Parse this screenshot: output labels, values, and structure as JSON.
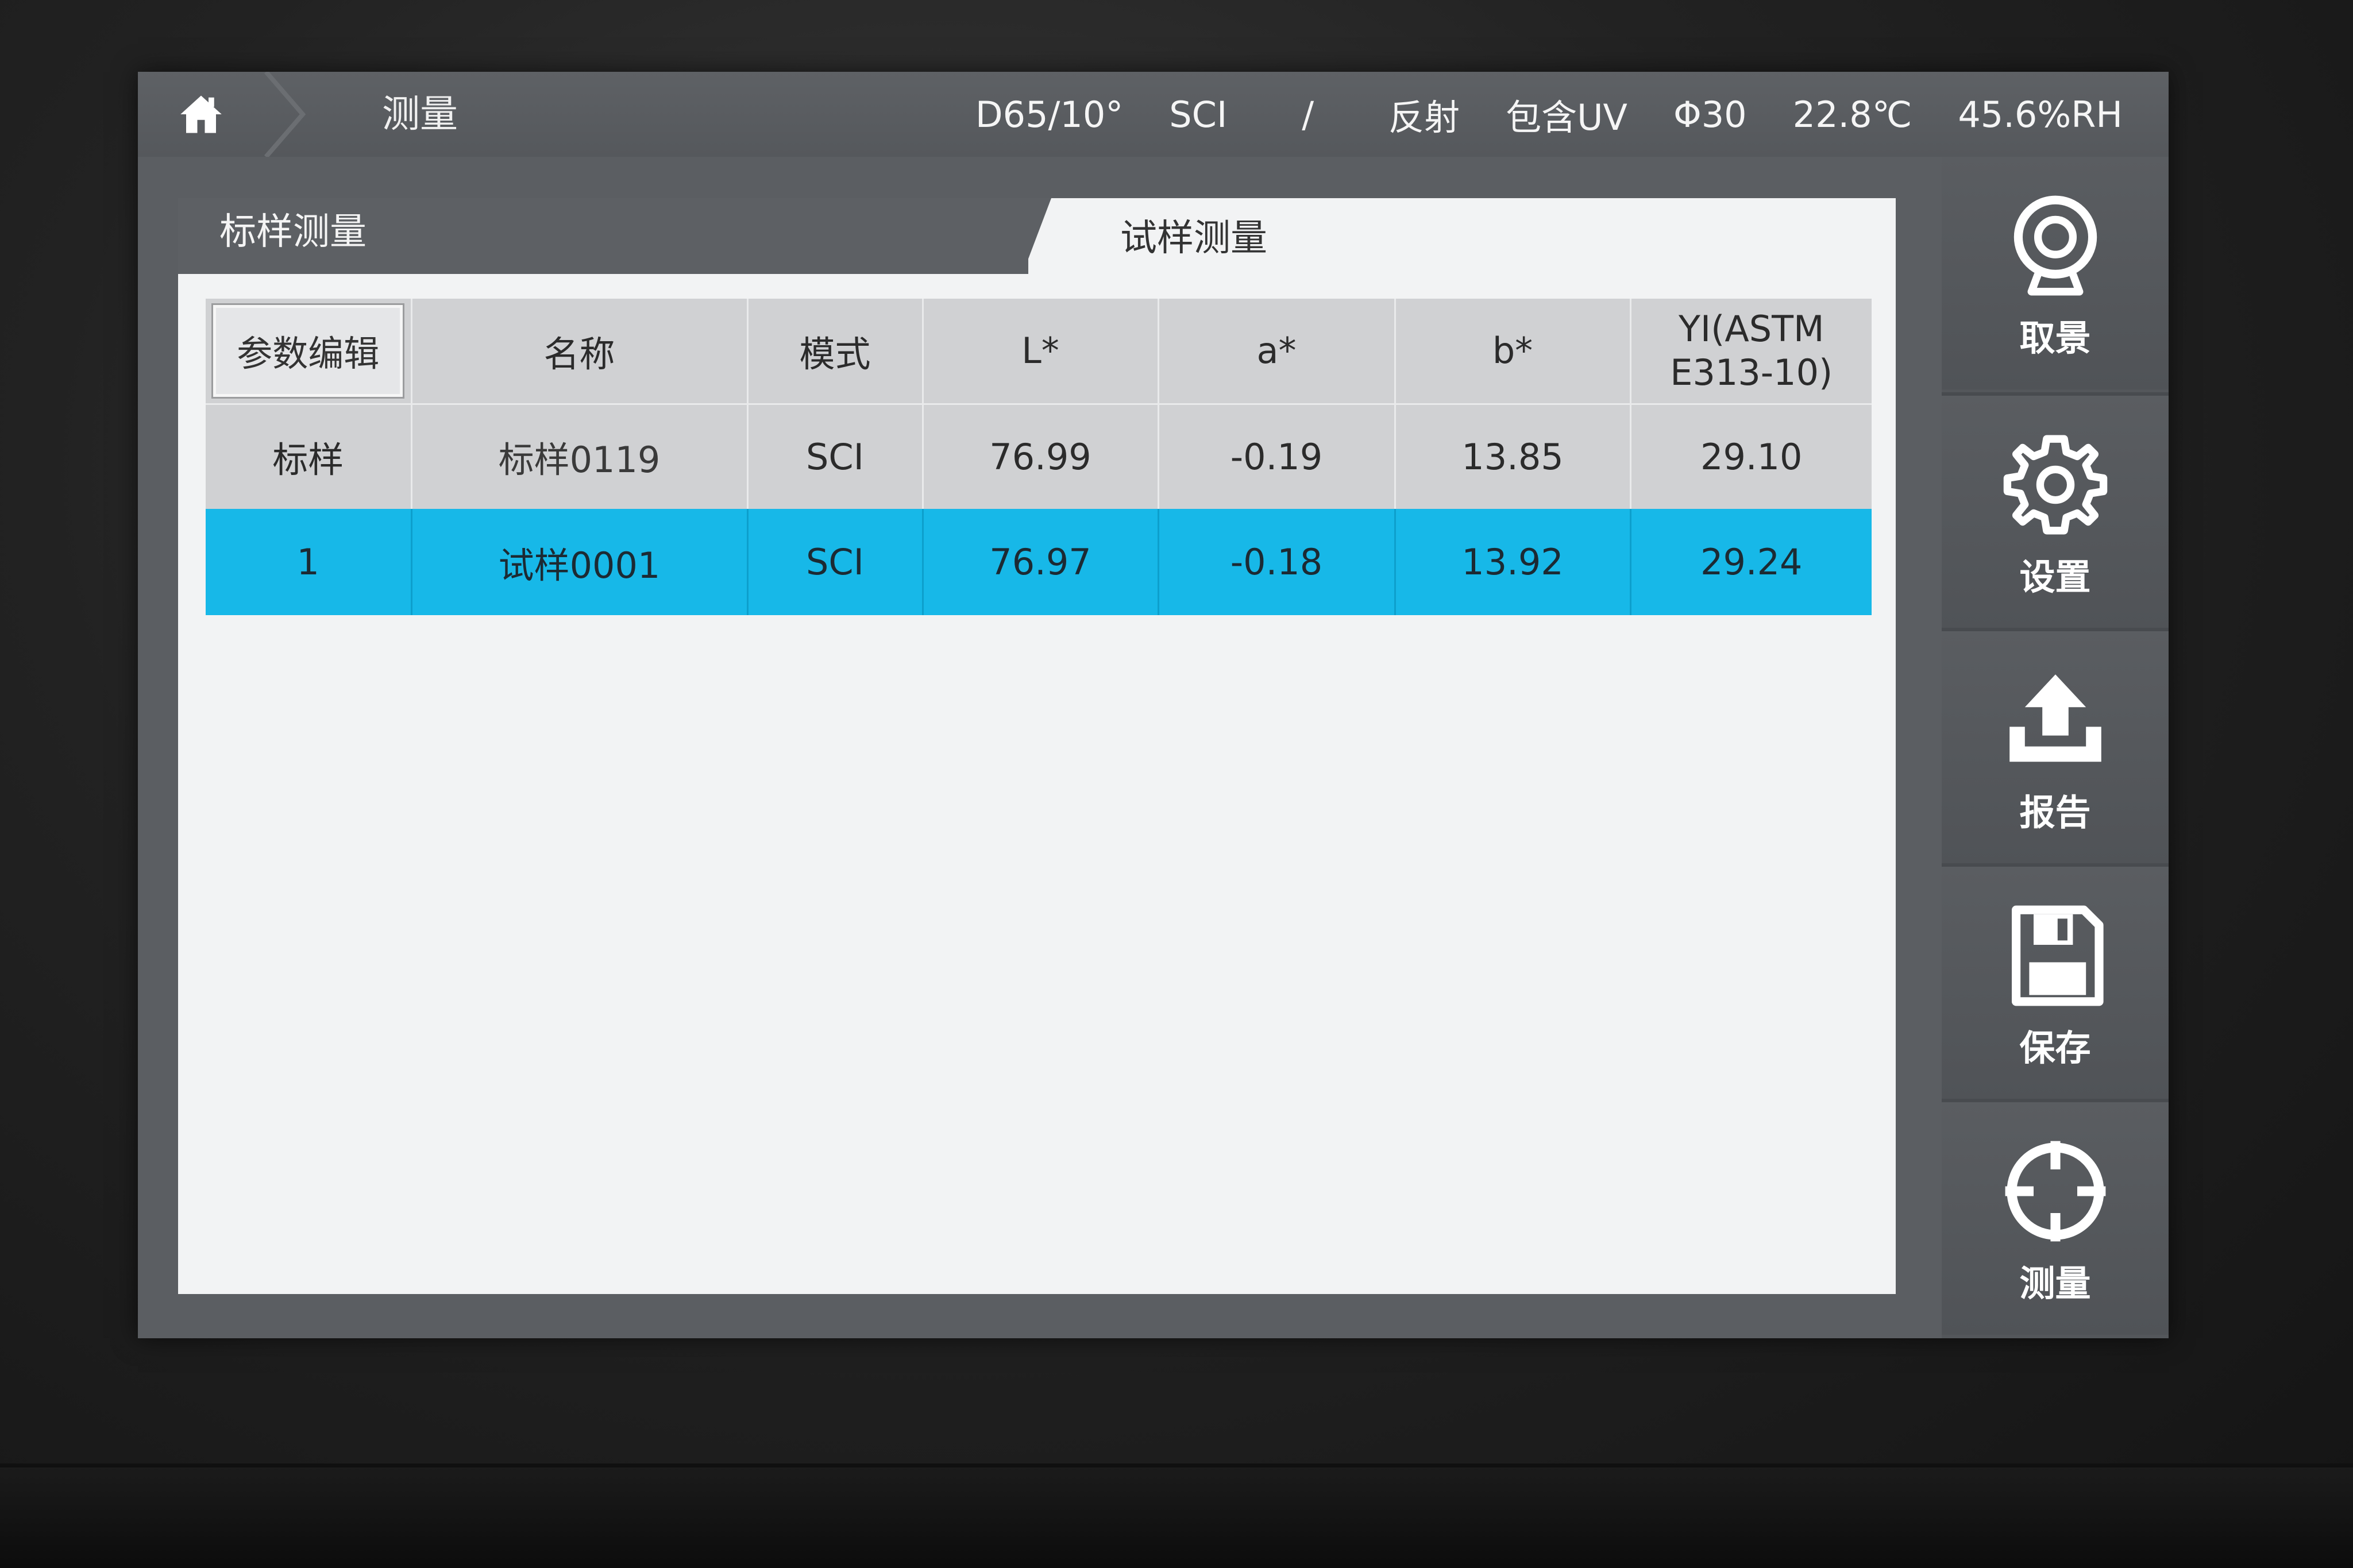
{
  "topbar": {
    "breadcrumb": "测量",
    "illuminant": "D65/10°",
    "specular": "SCI",
    "slash": "/",
    "mode": "反射",
    "uv": "包含UV",
    "aperture": "Φ30",
    "temperature": "22.8℃",
    "humidity": "45.6%RH"
  },
  "tabs": {
    "standard": "标样测量",
    "trial": "试样测量"
  },
  "table": {
    "edit_button": "参数编辑",
    "headers": {
      "name": "名称",
      "mode": "模式",
      "l": "L*",
      "a": "a*",
      "b": "b*",
      "yi_line1": "YI(ASTM",
      "yi_line2": "E313-10)"
    },
    "rows": [
      {
        "index": "标样",
        "name": "标样0119",
        "mode": "SCI",
        "l": "76.99",
        "a": "-0.19",
        "b": "13.85",
        "yi": "29.10"
      },
      {
        "index": "1",
        "name": "试样0001",
        "mode": "SCI",
        "l": "76.97",
        "a": "-0.18",
        "b": "13.92",
        "yi": "29.24"
      }
    ]
  },
  "actions": {
    "capture": {
      "label": "取景",
      "icon": "camera-icon"
    },
    "settings": {
      "label": "设置",
      "icon": "gear-icon"
    },
    "report": {
      "label": "报告",
      "icon": "upload-icon"
    },
    "save": {
      "label": "保存",
      "icon": "floppy-icon"
    },
    "measure": {
      "label": "测量",
      "icon": "crosshair-icon"
    }
  },
  "colors": {
    "selected_row": "#17b8e8",
    "header_bg": "#d0d1d3",
    "chrome": "#5b5e62"
  }
}
